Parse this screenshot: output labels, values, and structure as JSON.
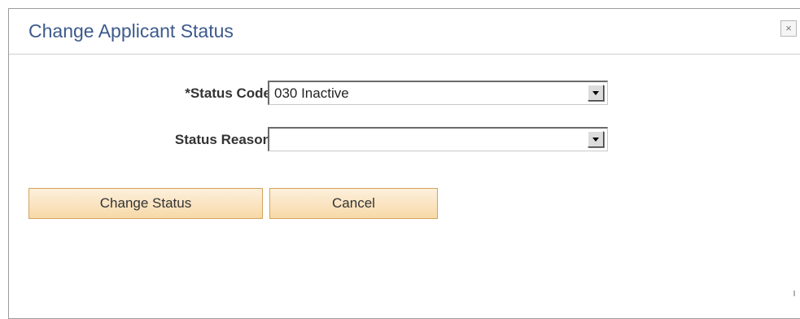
{
  "dialog": {
    "title": "Change Applicant Status",
    "close_label": "×"
  },
  "form": {
    "status_code": {
      "label": "*Status Code",
      "value": "030 Inactive"
    },
    "status_reason": {
      "label": "Status Reason",
      "value": ""
    }
  },
  "buttons": {
    "change_status_label": "Change Status",
    "cancel_label": "Cancel"
  },
  "icons": {
    "close": "close-icon",
    "dropdown": "chevron-down-icon"
  },
  "colors": {
    "title": "#3c5a8c",
    "button_border": "#d4a35b",
    "button_fill": "#f7d9a8"
  }
}
